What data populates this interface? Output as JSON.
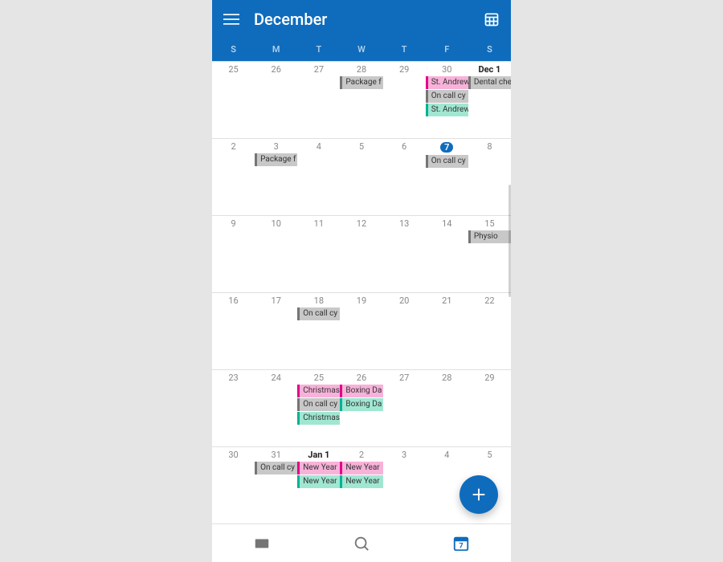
{
  "header": {
    "title": "December"
  },
  "weekdays": [
    "S",
    "M",
    "T",
    "W",
    "T",
    "F",
    "S"
  ],
  "weeks": [
    {
      "days": [
        {
          "num": "25",
          "bold": false,
          "today": false,
          "events": []
        },
        {
          "num": "26",
          "bold": false,
          "today": false,
          "events": []
        },
        {
          "num": "27",
          "bold": false,
          "today": false,
          "events": []
        },
        {
          "num": "28",
          "bold": false,
          "today": false,
          "events": [
            {
              "label": "Package f",
              "color": "gray"
            }
          ]
        },
        {
          "num": "29",
          "bold": false,
          "today": false,
          "events": []
        },
        {
          "num": "30",
          "bold": false,
          "today": false,
          "events": [
            {
              "label": "St. Andrew",
              "color": "pink"
            },
            {
              "label": "On call cy",
              "color": "gray"
            },
            {
              "label": "St. Andrew",
              "color": "mint"
            }
          ]
        },
        {
          "num": "Dec 1",
          "bold": true,
          "today": false,
          "events": [
            {
              "label": "Dental che",
              "color": "gray"
            }
          ]
        }
      ]
    },
    {
      "days": [
        {
          "num": "2",
          "bold": false,
          "today": false,
          "events": []
        },
        {
          "num": "3",
          "bold": false,
          "today": false,
          "events": [
            {
              "label": "Package f",
              "color": "gray"
            }
          ]
        },
        {
          "num": "4",
          "bold": false,
          "today": false,
          "events": []
        },
        {
          "num": "5",
          "bold": false,
          "today": false,
          "events": []
        },
        {
          "num": "6",
          "bold": false,
          "today": false,
          "events": []
        },
        {
          "num": "7",
          "bold": false,
          "today": true,
          "events": [
            {
              "label": "On call cy",
              "color": "gray"
            }
          ]
        },
        {
          "num": "8",
          "bold": false,
          "today": false,
          "events": []
        }
      ]
    },
    {
      "days": [
        {
          "num": "9",
          "bold": false,
          "today": false,
          "events": []
        },
        {
          "num": "10",
          "bold": false,
          "today": false,
          "events": []
        },
        {
          "num": "11",
          "bold": false,
          "today": false,
          "events": []
        },
        {
          "num": "12",
          "bold": false,
          "today": false,
          "events": []
        },
        {
          "num": "13",
          "bold": false,
          "today": false,
          "events": []
        },
        {
          "num": "14",
          "bold": false,
          "today": false,
          "events": []
        },
        {
          "num": "15",
          "bold": false,
          "today": false,
          "events": [
            {
              "label": "Physio",
              "color": "gray"
            }
          ]
        }
      ]
    },
    {
      "days": [
        {
          "num": "16",
          "bold": false,
          "today": false,
          "events": []
        },
        {
          "num": "17",
          "bold": false,
          "today": false,
          "events": []
        },
        {
          "num": "18",
          "bold": false,
          "today": false,
          "events": [
            {
              "label": "On call cy",
              "color": "gray"
            }
          ]
        },
        {
          "num": "19",
          "bold": false,
          "today": false,
          "events": []
        },
        {
          "num": "20",
          "bold": false,
          "today": false,
          "events": []
        },
        {
          "num": "21",
          "bold": false,
          "today": false,
          "events": []
        },
        {
          "num": "22",
          "bold": false,
          "today": false,
          "events": []
        }
      ]
    },
    {
      "days": [
        {
          "num": "23",
          "bold": false,
          "today": false,
          "events": []
        },
        {
          "num": "24",
          "bold": false,
          "today": false,
          "events": []
        },
        {
          "num": "25",
          "bold": false,
          "today": false,
          "events": [
            {
              "label": "Christmas",
              "color": "pink"
            },
            {
              "label": "On call cy",
              "color": "gray"
            },
            {
              "label": "Christmas",
              "color": "mint"
            }
          ]
        },
        {
          "num": "26",
          "bold": false,
          "today": false,
          "events": [
            {
              "label": "Boxing Da",
              "color": "pink"
            },
            {
              "label": "Boxing Da",
              "color": "mint"
            }
          ]
        },
        {
          "num": "27",
          "bold": false,
          "today": false,
          "events": []
        },
        {
          "num": "28",
          "bold": false,
          "today": false,
          "events": []
        },
        {
          "num": "29",
          "bold": false,
          "today": false,
          "events": []
        }
      ]
    },
    {
      "days": [
        {
          "num": "30",
          "bold": false,
          "today": false,
          "events": []
        },
        {
          "num": "31",
          "bold": false,
          "today": false,
          "events": [
            {
              "label": "On call cy",
              "color": "gray"
            }
          ]
        },
        {
          "num": "Jan 1",
          "bold": true,
          "today": false,
          "events": [
            {
              "label": "New Year",
              "color": "pink"
            },
            {
              "label": "New Year",
              "color": "mint"
            }
          ]
        },
        {
          "num": "2",
          "bold": false,
          "today": false,
          "events": [
            {
              "label": "New Year",
              "color": "pink"
            },
            {
              "label": "New Year",
              "color": "mint"
            }
          ]
        },
        {
          "num": "3",
          "bold": false,
          "today": false,
          "events": []
        },
        {
          "num": "4",
          "bold": false,
          "today": false,
          "events": []
        },
        {
          "num": "5",
          "bold": false,
          "today": false,
          "events": []
        }
      ]
    }
  ],
  "bottomNav": {
    "calendarDay": "7"
  }
}
